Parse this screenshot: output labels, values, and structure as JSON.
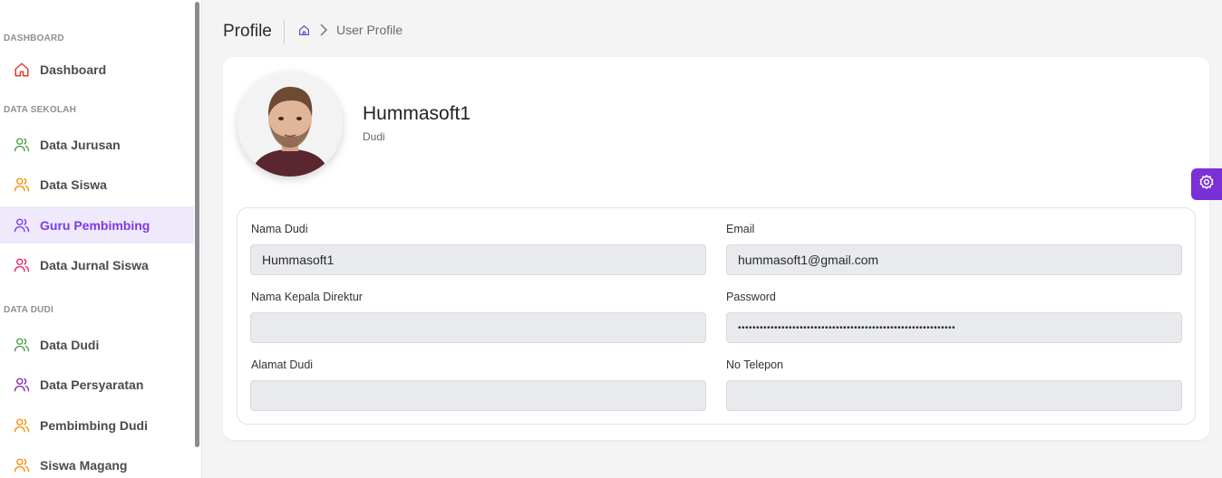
{
  "sidebar": {
    "sections": [
      "DASHBOARD",
      "DATA SEKOLAH",
      "DATA DUDI"
    ],
    "items": [
      {
        "label": "Dashboard",
        "icon": "home-icon",
        "color": "#e53935"
      },
      {
        "label": "Data Jurusan",
        "icon": "users-icon",
        "color": "#43a047"
      },
      {
        "label": "Data Siswa",
        "icon": "users-icon",
        "color": "#fb8c00"
      },
      {
        "label": "Guru Pembimbing",
        "icon": "users-icon",
        "color": "#7c3aed"
      },
      {
        "label": "Data Jurnal Siswa",
        "icon": "users-icon",
        "color": "#e91e63"
      },
      {
        "label": "Data Dudi",
        "icon": "users-icon",
        "color": "#43a047"
      },
      {
        "label": "Data Persyaratan",
        "icon": "users-icon",
        "color": "#8e24aa"
      },
      {
        "label": "Pembimbing Dudi",
        "icon": "users-icon",
        "color": "#fb8c00"
      },
      {
        "label": "Siswa Magang",
        "icon": "users-icon",
        "color": "#fb8c00"
      }
    ],
    "active": "Guru Pembimbing"
  },
  "header": {
    "title": "Profile",
    "breadcrumb": [
      "home-icon",
      "User Profile"
    ]
  },
  "profile": {
    "name": "Hummasoft1",
    "role": "Dudi"
  },
  "form": {
    "nama_dudi": {
      "label": "Nama Dudi",
      "value": "Hummasoft1"
    },
    "email": {
      "label": "Email",
      "value": "hummasoft1@gmail.com"
    },
    "kepala": {
      "label": "Nama Kepala Direktur",
      "value": ""
    },
    "password": {
      "label": "Password",
      "value": "••••••••••••••••••••••••••••••••••••••••••••••••••••••••••••"
    },
    "alamat": {
      "label": "Alamat Dudi",
      "value": ""
    },
    "telepon": {
      "label": "No Telepon",
      "value": ""
    }
  },
  "colors": {
    "accent": "#7c3aed",
    "settings_button": "#7b2fd6",
    "input_bg": "#e8eaed"
  }
}
